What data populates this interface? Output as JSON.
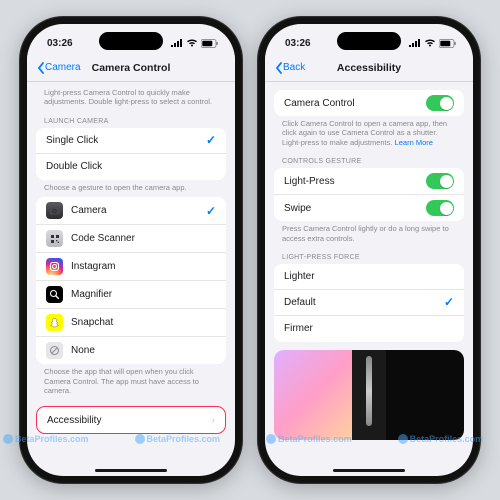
{
  "status": {
    "time": "03:26"
  },
  "left": {
    "back": "Camera",
    "title": "Camera Control",
    "header_intro": "Light-press Camera Control to quickly make adjustments. Double light-press to select a control.",
    "launch_header": "LAUNCH CAMERA",
    "launch_opts": {
      "single": "Single Click",
      "double": "Double Click"
    },
    "launch_footer": "Choose a gesture to open the camera app.",
    "apps": {
      "camera": "Camera",
      "code": "Code Scanner",
      "ig": "Instagram",
      "mag": "Magnifier",
      "snap": "Snapchat",
      "none": "None"
    },
    "apps_footer": "Choose the app that will open when you click Camera Control. The app must have access to camera.",
    "accessibility": "Accessibility"
  },
  "right": {
    "back": "Back",
    "title": "Accessibility",
    "camctrl": "Camera Control",
    "camctrl_footer_a": "Click Camera Control to open a camera app, then click again to use Camera Control as a shutter. Light-press to make adjustments. ",
    "learn": "Learn More",
    "gesture_header": "CONTROLS GESTURE",
    "lightpress": "Light-Press",
    "swipe": "Swipe",
    "gesture_footer": "Press Camera Control lightly or do a long swipe to access extra controls.",
    "force_header": "LIGHT-PRESS FORCE",
    "force": {
      "lighter": "Lighter",
      "default": "Default",
      "firmer": "Firmer"
    }
  },
  "watermark": "BetaProfiles.com"
}
